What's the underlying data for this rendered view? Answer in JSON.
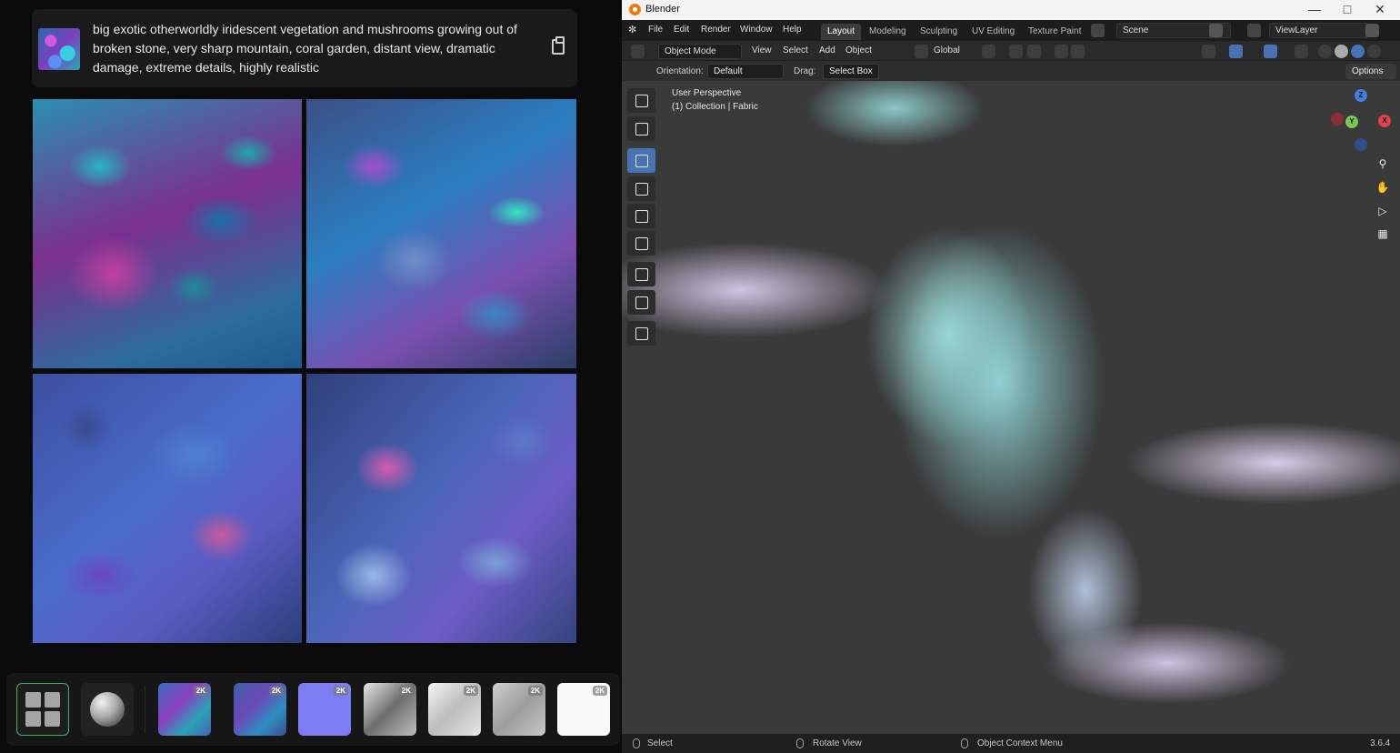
{
  "prompt": {
    "text": "big exotic otherworldly iridescent vegetation and mushrooms growing out of broken stone, very sharp mountain, coral garden, distant view, dramatic damage, extreme details, highly realistic",
    "copy_icon": "clipboard-icon"
  },
  "dock": {
    "badges": [
      "2K",
      "2K",
      "2K",
      "2K",
      "2K",
      "2K",
      "2K"
    ]
  },
  "blender": {
    "title": "Blender",
    "menu": [
      "File",
      "Edit",
      "Render",
      "Window",
      "Help"
    ],
    "workspaces": [
      "Layout",
      "Modeling",
      "Sculpting",
      "UV Editing",
      "Texture Paint"
    ],
    "scene": "Scene",
    "view_layer": "ViewLayer",
    "header": {
      "mode": "Object Mode",
      "menus": [
        "View",
        "Select",
        "Add",
        "Object"
      ],
      "transform": "Global"
    },
    "subheader": {
      "orientation_label": "Orientation:",
      "orientation_value": "Default",
      "drag_label": "Drag:",
      "drag_value": "Select Box",
      "options": "Options"
    },
    "viewport": {
      "perspective": "User Perspective",
      "collection": "(1) Collection | Fabric",
      "gizmo": [
        "Z",
        "Y",
        "X"
      ]
    },
    "status": {
      "select": "Select",
      "rotate": "Rotate View",
      "context": "Object Context Menu",
      "version": "3.6.4"
    }
  },
  "colors": {
    "accent_green": "#3fb26a",
    "blender_blue": "#4772b3",
    "blender_orange": "#e87d0d"
  }
}
